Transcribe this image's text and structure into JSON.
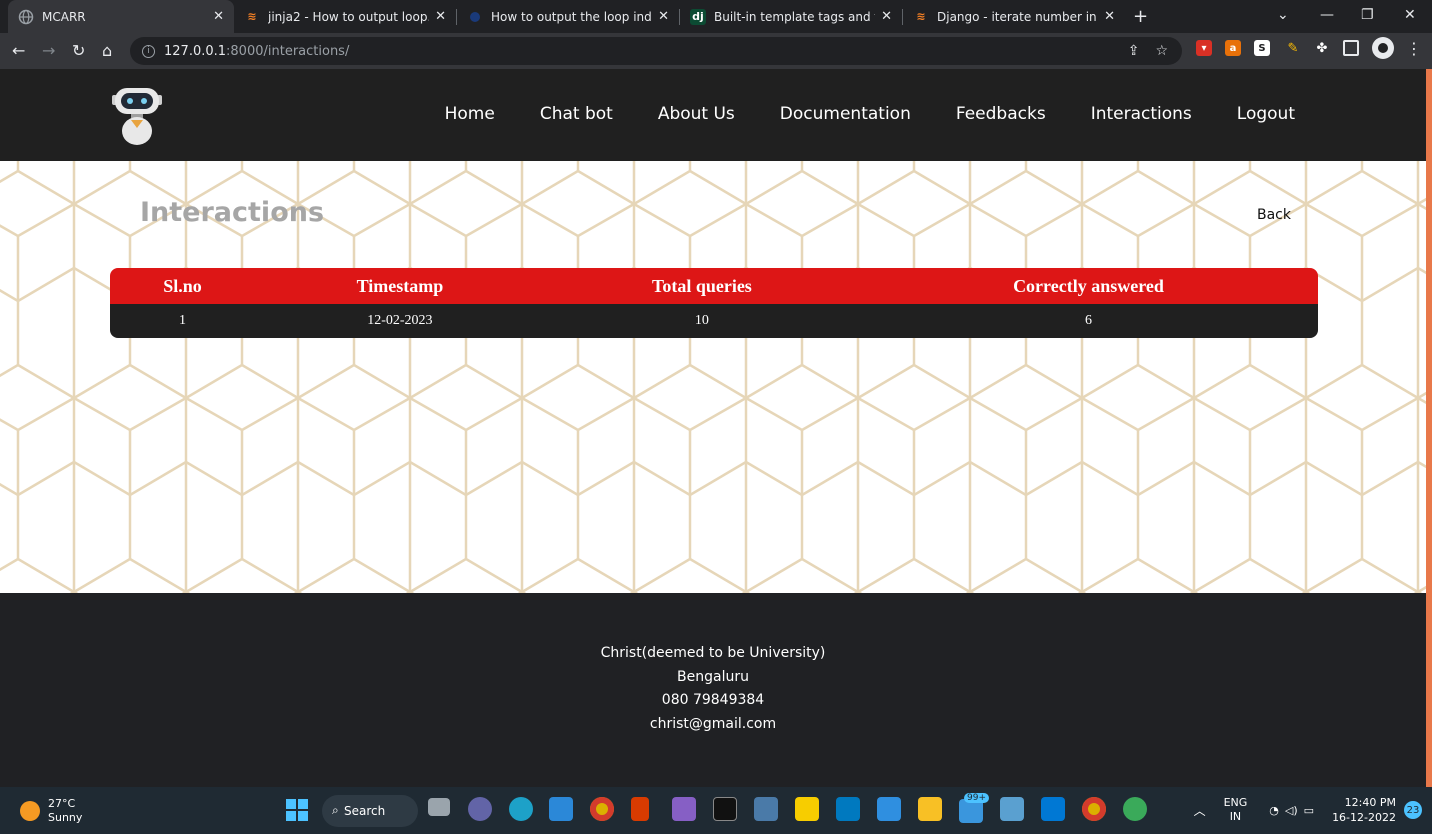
{
  "browser": {
    "tabs": [
      {
        "title": "MCARR",
        "active": true
      },
      {
        "title": "jinja2 - How to output loop.coun"
      },
      {
        "title": "How to output the loop index fo"
      },
      {
        "title": "Built-in template tags and filters"
      },
      {
        "title": "Django - iterate number in for lo"
      }
    ],
    "url_host": "127.0.0.1",
    "url_path": ":8000/interactions/"
  },
  "site": {
    "nav": [
      "Home",
      "Chat bot",
      "About Us",
      "Documentation",
      "Feedbacks",
      "Interactions",
      "Logout"
    ],
    "page_title": "Interactions",
    "back_label": "Back"
  },
  "table": {
    "headers": [
      "Sl.no",
      "Timestamp",
      "Total queries",
      "Correctly answered"
    ],
    "rows": [
      [
        "1",
        "12-02-2023",
        "10",
        "6"
      ]
    ]
  },
  "footer": {
    "lines": [
      "Christ(deemed to be University)",
      "Bengaluru",
      "080 79849384",
      "christ@gmail.com"
    ]
  },
  "taskbar": {
    "temperature": "27°C",
    "weather": "Sunny",
    "search_label": "Search",
    "mail_badge": "99+",
    "lang": "ENG",
    "region": "IN",
    "time": "12:40 PM",
    "date": "16-12-2022",
    "notif_count": "23"
  },
  "colors": {
    "header_bg": "#202020",
    "table_header_bg": "#dd1616",
    "table_row_bg": "#202020",
    "page_title": "#a6a6a6",
    "pattern_line": "#e6d6b8",
    "scroll_accent": "#e8784a"
  }
}
